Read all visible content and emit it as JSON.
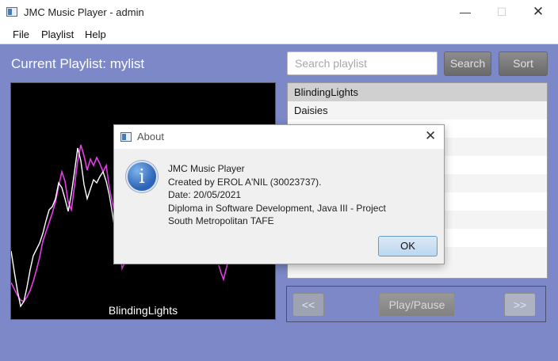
{
  "window": {
    "title": "JMC Music Player - admin",
    "minimize": "—",
    "maximize": "☐",
    "close": "✕"
  },
  "menu": [
    "File",
    "Playlist",
    "Help"
  ],
  "current_playlist": "Current Playlist:  mylist",
  "search": {
    "placeholder": "Search playlist",
    "value": ""
  },
  "buttons": {
    "search": "Search",
    "sort": "Sort"
  },
  "playlist": [
    "BlindingLights",
    "Daisies",
    "",
    "",
    "",
    "",
    "",
    "",
    "",
    ""
  ],
  "selected_index": 0,
  "visualizer": {
    "song": "BlindingLights",
    "colors": {
      "background": "#000000",
      "left_channel": "#ffffff",
      "right_channel": "#e83ce8"
    }
  },
  "controls": {
    "prev": "<<",
    "play_pause": "Play/Pause",
    "next": ">>"
  },
  "dialog": {
    "title": "About",
    "close": "✕",
    "icon": "info-icon",
    "lines": [
      "JMC Music Player",
      "Created by EROL A'NIL (30023737).",
      "Date: 20/05/2021",
      "Diploma in Software Development, Java III - Project",
      "South Metropolitan TAFE"
    ],
    "ok": "OK"
  },
  "colors": {
    "background": "#7c88c8",
    "dialog_ok": "#bcd7ee",
    "button_gray": "#7a7a7a"
  }
}
